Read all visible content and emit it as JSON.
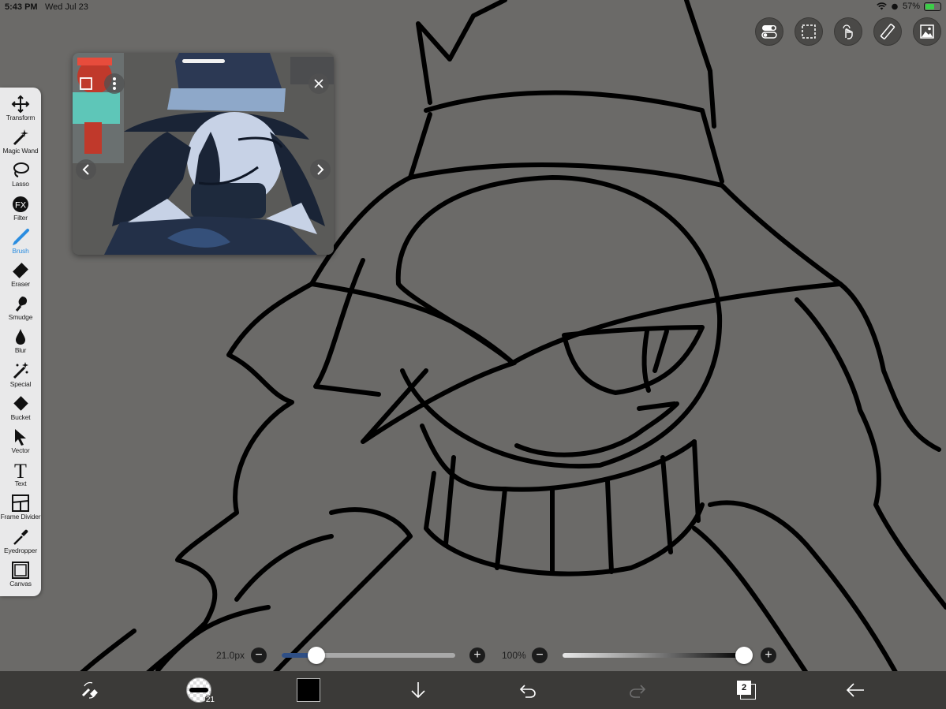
{
  "status_bar": {
    "time": "5:43 PM",
    "date": "Wed Jul 23",
    "battery": "57%"
  },
  "colors": {
    "canvas_bg": "#6b6a68",
    "accent": "#2b8de0",
    "toolbar_bg": "#e9e9ea",
    "bottom_bar_bg": "#3b3a38"
  },
  "top_tools": [
    {
      "name": "toggle-icon"
    },
    {
      "name": "selection-icon"
    },
    {
      "name": "gesture-icon"
    },
    {
      "name": "ruler-icon"
    },
    {
      "name": "material-icon"
    }
  ],
  "toolbar": {
    "tools": [
      {
        "label": "Transform",
        "icon": "move-arrows-icon",
        "active": false
      },
      {
        "label": "Magic Wand",
        "icon": "magic-wand-icon",
        "active": false
      },
      {
        "label": "Lasso",
        "icon": "lasso-icon",
        "active": false
      },
      {
        "label": "Filter",
        "icon": "fx-icon",
        "active": false
      },
      {
        "label": "Brush",
        "icon": "brush-icon",
        "active": true
      },
      {
        "label": "Eraser",
        "icon": "eraser-icon",
        "active": false
      },
      {
        "label": "Smudge",
        "icon": "smudge-icon",
        "active": false
      },
      {
        "label": "Blur",
        "icon": "drop-icon",
        "active": false
      },
      {
        "label": "Special",
        "icon": "sparkle-icon",
        "active": false
      },
      {
        "label": "Bucket",
        "icon": "bucket-icon",
        "active": false
      },
      {
        "label": "Vector",
        "icon": "cursor-arrow-icon",
        "active": false
      },
      {
        "label": "Text",
        "icon": "text-icon",
        "active": false
      },
      {
        "label": "Frame Divider",
        "icon": "frame-divider-icon",
        "active": false
      },
      {
        "label": "Eyedropper",
        "icon": "eyedropper-icon",
        "active": false
      },
      {
        "label": "Canvas",
        "icon": "canvas-icon",
        "active": false
      }
    ]
  },
  "brush": {
    "size_label": "21.0px",
    "size_fraction": 0.2,
    "opacity_label": "100%",
    "opacity_fraction": 1.0
  },
  "bottom_bar": {
    "brush_size_badge": "21",
    "current_color": "#000000",
    "layer_count": "2"
  }
}
